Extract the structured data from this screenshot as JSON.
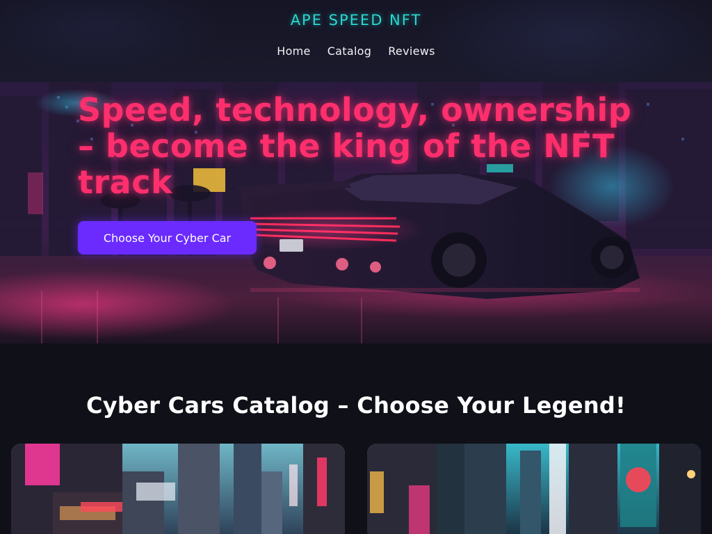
{
  "header": {
    "brand": "APE SPEED NFT",
    "nav": [
      {
        "label": "Home"
      },
      {
        "label": "Catalog"
      },
      {
        "label": "Reviews"
      }
    ]
  },
  "hero": {
    "title": "Speed, technology, ownership – become the king of the NFT track",
    "cta_label": "Choose Your Cyber Car",
    "image": "cyberpunk-car-night-city"
  },
  "catalog": {
    "title": "Cyber Cars Catalog – Choose Your Legend!",
    "cards": [
      {
        "image": "neon-city-street-pink"
      },
      {
        "image": "neon-city-street-cyan"
      }
    ]
  },
  "colors": {
    "brand": "#2ad8d0",
    "hero_title": "#ff2f6e",
    "cta": "#6b2bff",
    "background": "#0f1018"
  }
}
